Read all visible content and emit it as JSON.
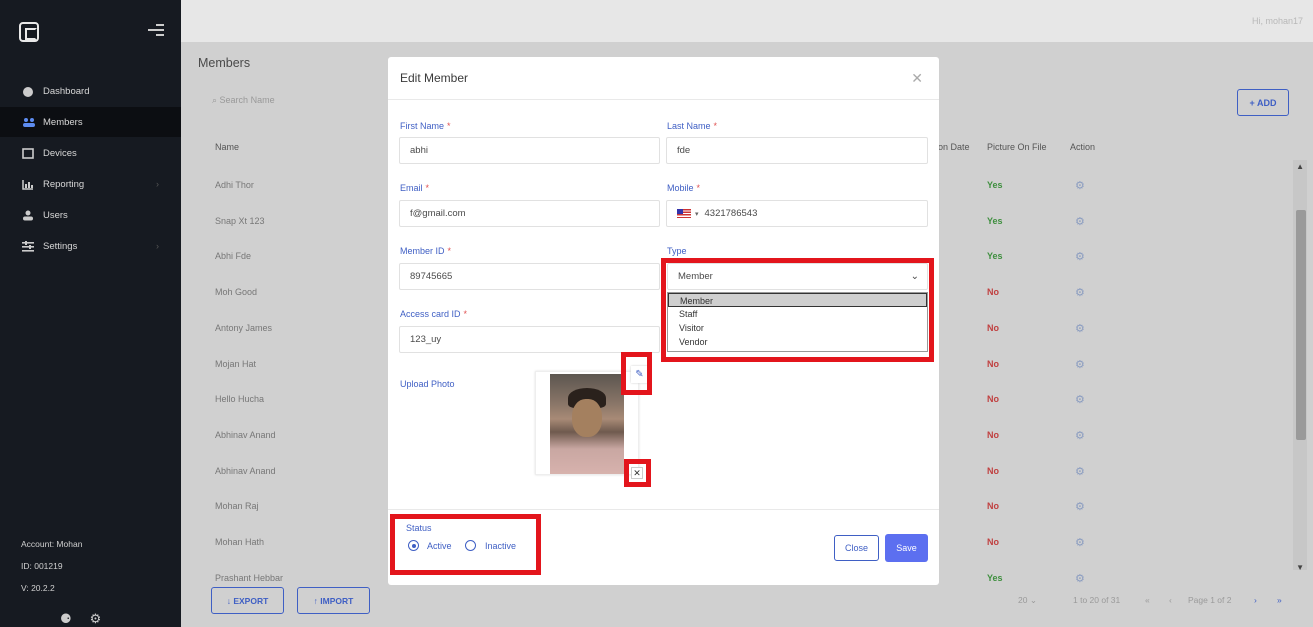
{
  "header": {
    "greeting": "Hi, mohan17"
  },
  "sidebar": {
    "items": [
      {
        "label": "Dashboard",
        "icon": "dashboard-icon"
      },
      {
        "label": "Members",
        "icon": "members-icon"
      },
      {
        "label": "Devices",
        "icon": "device-icon"
      },
      {
        "label": "Reporting",
        "icon": "chart-icon"
      },
      {
        "label": "Users",
        "icon": "user-icon"
      },
      {
        "label": "Settings",
        "icon": "sliders-icon"
      }
    ],
    "account": "Account: Mohan",
    "id": "ID: 001219",
    "version": "V: 20.2.2"
  },
  "page": {
    "title": "Members",
    "search_placeholder": "Search Name",
    "add_label": "+ ADD",
    "columns": [
      "Name",
      "on Date",
      "Picture On File",
      "Action"
    ],
    "rows": [
      {
        "name": "Adhi Thor",
        "picture": "Yes"
      },
      {
        "name": "Snap Xt 123",
        "picture": "Yes"
      },
      {
        "name": "Abhi Fde",
        "picture": "Yes"
      },
      {
        "name": "Moh Good",
        "picture": "No"
      },
      {
        "name": "Antony James",
        "picture": "No"
      },
      {
        "name": "Mojan Hat",
        "picture": "No"
      },
      {
        "name": "Hello Hucha",
        "picture": "No"
      },
      {
        "name": "Abhinav Anand",
        "picture": "No"
      },
      {
        "name": "Abhinav Anand",
        "picture": "No"
      },
      {
        "name": "Mohan Raj",
        "picture": "No"
      },
      {
        "name": "Mohan Hath",
        "picture": "No"
      },
      {
        "name": "Prashant Hebbar",
        "picture": "Yes"
      }
    ],
    "export_label": "↓ EXPORT",
    "import_label": "↑ IMPORT",
    "range_text": "1 to 20 of 31",
    "page_text": "Page 1 of 2"
  },
  "modal": {
    "title": "Edit Member",
    "first_name_label": "First Name",
    "first_name": "abhi",
    "last_name_label": "Last Name",
    "last_name": "fde",
    "email_label": "Email",
    "email": "f@gmail.com",
    "mobile_label": "Mobile",
    "mobile": "4321786543",
    "member_id_label": "Member ID",
    "member_id": "89745665",
    "type_label": "Type",
    "type_value": "Member",
    "type_options": [
      "Member",
      "Staff",
      "Visitor",
      "Vendor"
    ],
    "access_card_label": "Access card ID",
    "access_card": "123_uy",
    "upload_label": "Upload Photo",
    "status_label": "Status",
    "status_active": "Active",
    "status_inactive": "Inactive",
    "close_label": "Close",
    "save_label": "Save",
    "required_mark": "*"
  },
  "colors": {
    "accent": "#3f5fc4",
    "highlight": "#e3151c",
    "sidebar": "#161a21"
  }
}
